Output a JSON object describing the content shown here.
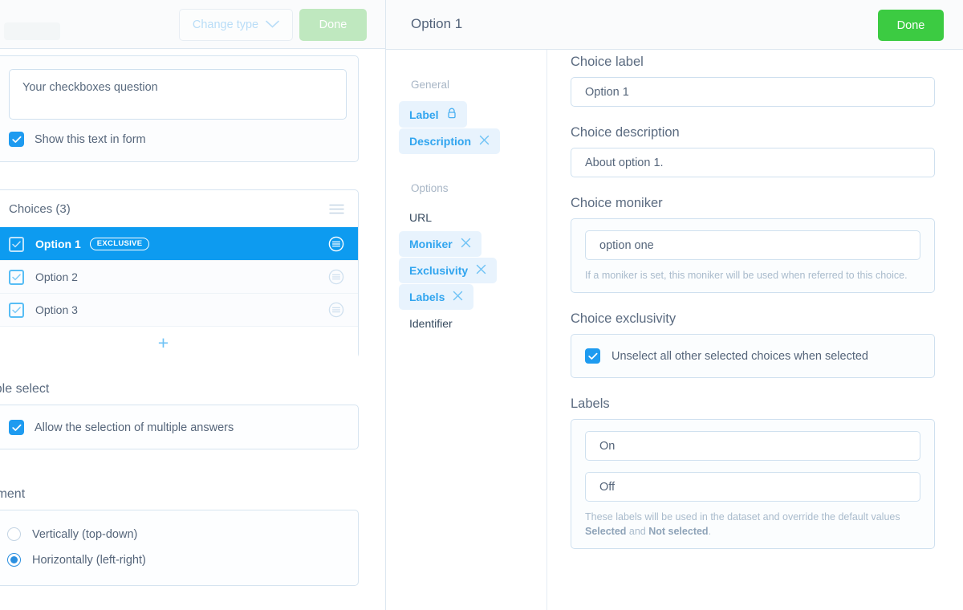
{
  "left_panel": {
    "toolbar": {
      "change_type_label": "Change type",
      "change_type_icon": "chevron-down-icon",
      "done_label": "Done"
    },
    "question": {
      "text": "Your checkboxes question",
      "show_in_form_label": "Show this text in form",
      "show_in_form_checked": true
    },
    "choices": {
      "header": "Choices (3)",
      "reorder_icon": "hamburger-icon",
      "items": [
        {
          "label": "Option 1",
          "badge": "EXCLUSIVE",
          "checked": true,
          "selected": true,
          "menu_icon": "circle-menu-icon"
        },
        {
          "label": "Option 2",
          "badge": "",
          "checked": true,
          "selected": false,
          "menu_icon": "circle-menu-icon"
        },
        {
          "label": "Option 3",
          "badge": "",
          "checked": true,
          "selected": false,
          "menu_icon": "circle-menu-icon"
        }
      ],
      "add_label": "+"
    },
    "multiple_select": {
      "heading": "Multiple select",
      "option_label": "Allow the selection of multiple answers",
      "checked": true
    },
    "alignment": {
      "heading": "Alignment",
      "options": [
        {
          "label": "Vertically (top-down)",
          "selected": false
        },
        {
          "label": "Horizontally (left-right)",
          "selected": true
        }
      ]
    }
  },
  "right_panel": {
    "title": "Option 1",
    "done_label": "Done",
    "nav": {
      "groups": [
        {
          "label": "General",
          "items": [
            {
              "label": "Label",
              "active": true,
              "trailing_icon": "lock-icon"
            },
            {
              "label": "Description",
              "active": true,
              "trailing_icon": "close-icon"
            }
          ]
        },
        {
          "label": "Options",
          "items": [
            {
              "label": "URL",
              "active": false,
              "trailing_icon": ""
            },
            {
              "label": "Moniker",
              "active": true,
              "trailing_icon": "close-icon"
            },
            {
              "label": "Exclusivity",
              "active": true,
              "trailing_icon": "close-icon"
            },
            {
              "label": "Labels",
              "active": true,
              "trailing_icon": "close-icon"
            },
            {
              "label": "Identifier",
              "active": false,
              "trailing_icon": ""
            }
          ]
        }
      ]
    },
    "fields": {
      "choice_label": {
        "label": "Choice label",
        "value": "Option 1"
      },
      "choice_description": {
        "label": "Choice description",
        "value": "About option 1."
      },
      "choice_moniker": {
        "label": "Choice moniker",
        "value": "option one",
        "hint": "If a moniker is set, this moniker will be used when referred to this choice."
      },
      "choice_exclusivity": {
        "label": "Choice exclusivity",
        "option_label": "Unselect all other selected choices when selected",
        "checked": true
      },
      "labels": {
        "label": "Labels",
        "on_value": "On",
        "off_value": "Off",
        "hint_prefix": "These labels will be used in the dataset and override the default values ",
        "hint_bold1": "Selected",
        "hint_mid": " and ",
        "hint_bold2": "Not selected",
        "hint_suffix": "."
      }
    }
  },
  "colors": {
    "accent_blue": "#0d9bf0",
    "light_blue": "#31a5ef",
    "done_green": "#3ccb42",
    "done_green_disabled": "#bfe8bf",
    "chip_bg": "#e8f3fd",
    "border": "#cfe0ef"
  }
}
